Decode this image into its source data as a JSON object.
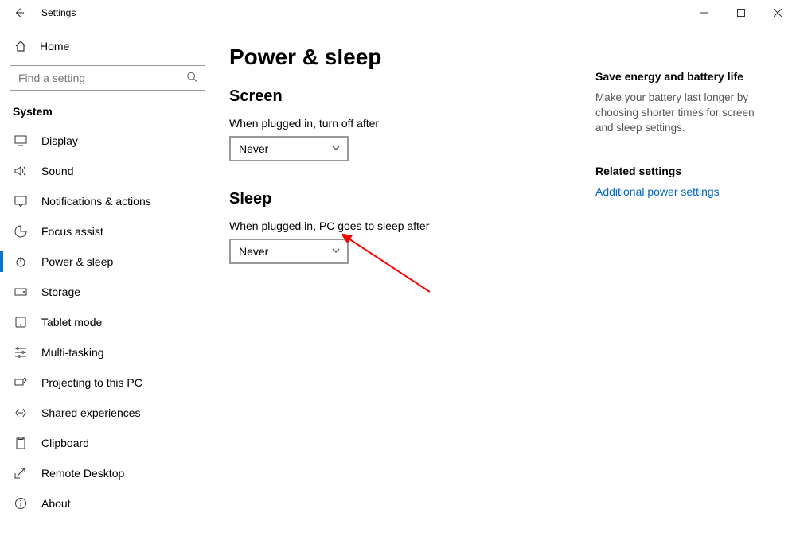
{
  "titlebar": {
    "title": "Settings"
  },
  "sidebar": {
    "home": "Home",
    "search_placeholder": "Find a setting",
    "category": "System",
    "items": [
      {
        "label": "Display"
      },
      {
        "label": "Sound"
      },
      {
        "label": "Notifications & actions"
      },
      {
        "label": "Focus assist"
      },
      {
        "label": "Power & sleep"
      },
      {
        "label": "Storage"
      },
      {
        "label": "Tablet mode"
      },
      {
        "label": "Multi-tasking"
      },
      {
        "label": "Projecting to this PC"
      },
      {
        "label": "Shared experiences"
      },
      {
        "label": "Clipboard"
      },
      {
        "label": "Remote Desktop"
      },
      {
        "label": "About"
      }
    ]
  },
  "main": {
    "title": "Power & sleep",
    "screen": {
      "heading": "Screen",
      "label": "When plugged in, turn off after",
      "value": "Never"
    },
    "sleep": {
      "heading": "Sleep",
      "label": "When plugged in, PC goes to sleep after",
      "value": "Never"
    }
  },
  "aside": {
    "energy_heading": "Save energy and battery life",
    "energy_text": "Make your battery last longer by choosing shorter times for screen and sleep settings.",
    "related_heading": "Related settings",
    "related_link": "Additional power settings"
  }
}
